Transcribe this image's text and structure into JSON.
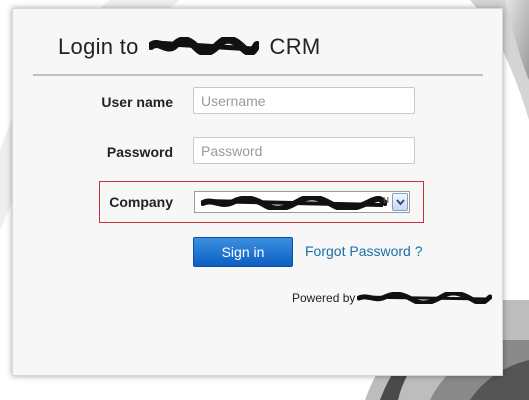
{
  "login": {
    "title_prefix": "Login to",
    "title_suffix": "CRM",
    "username_label": "User name",
    "username_placeholder": "Username",
    "username_value": "",
    "password_label": "Password",
    "password_placeholder": "Password",
    "password_value": "",
    "company_label": "Company",
    "company_selected_tail": "u",
    "signin_label": "Sign in",
    "forgot_label": "Forgot Password ?",
    "powered_label": "Powered by"
  },
  "colors": {
    "primary_button": "#0d5fc2",
    "link": "#1a6fa8",
    "highlight_border": "#c9303a",
    "card_background": "#f7f7f7"
  },
  "icons": {
    "select_arrow": "chevron-down-icon",
    "redaction": "scribble-redaction"
  }
}
